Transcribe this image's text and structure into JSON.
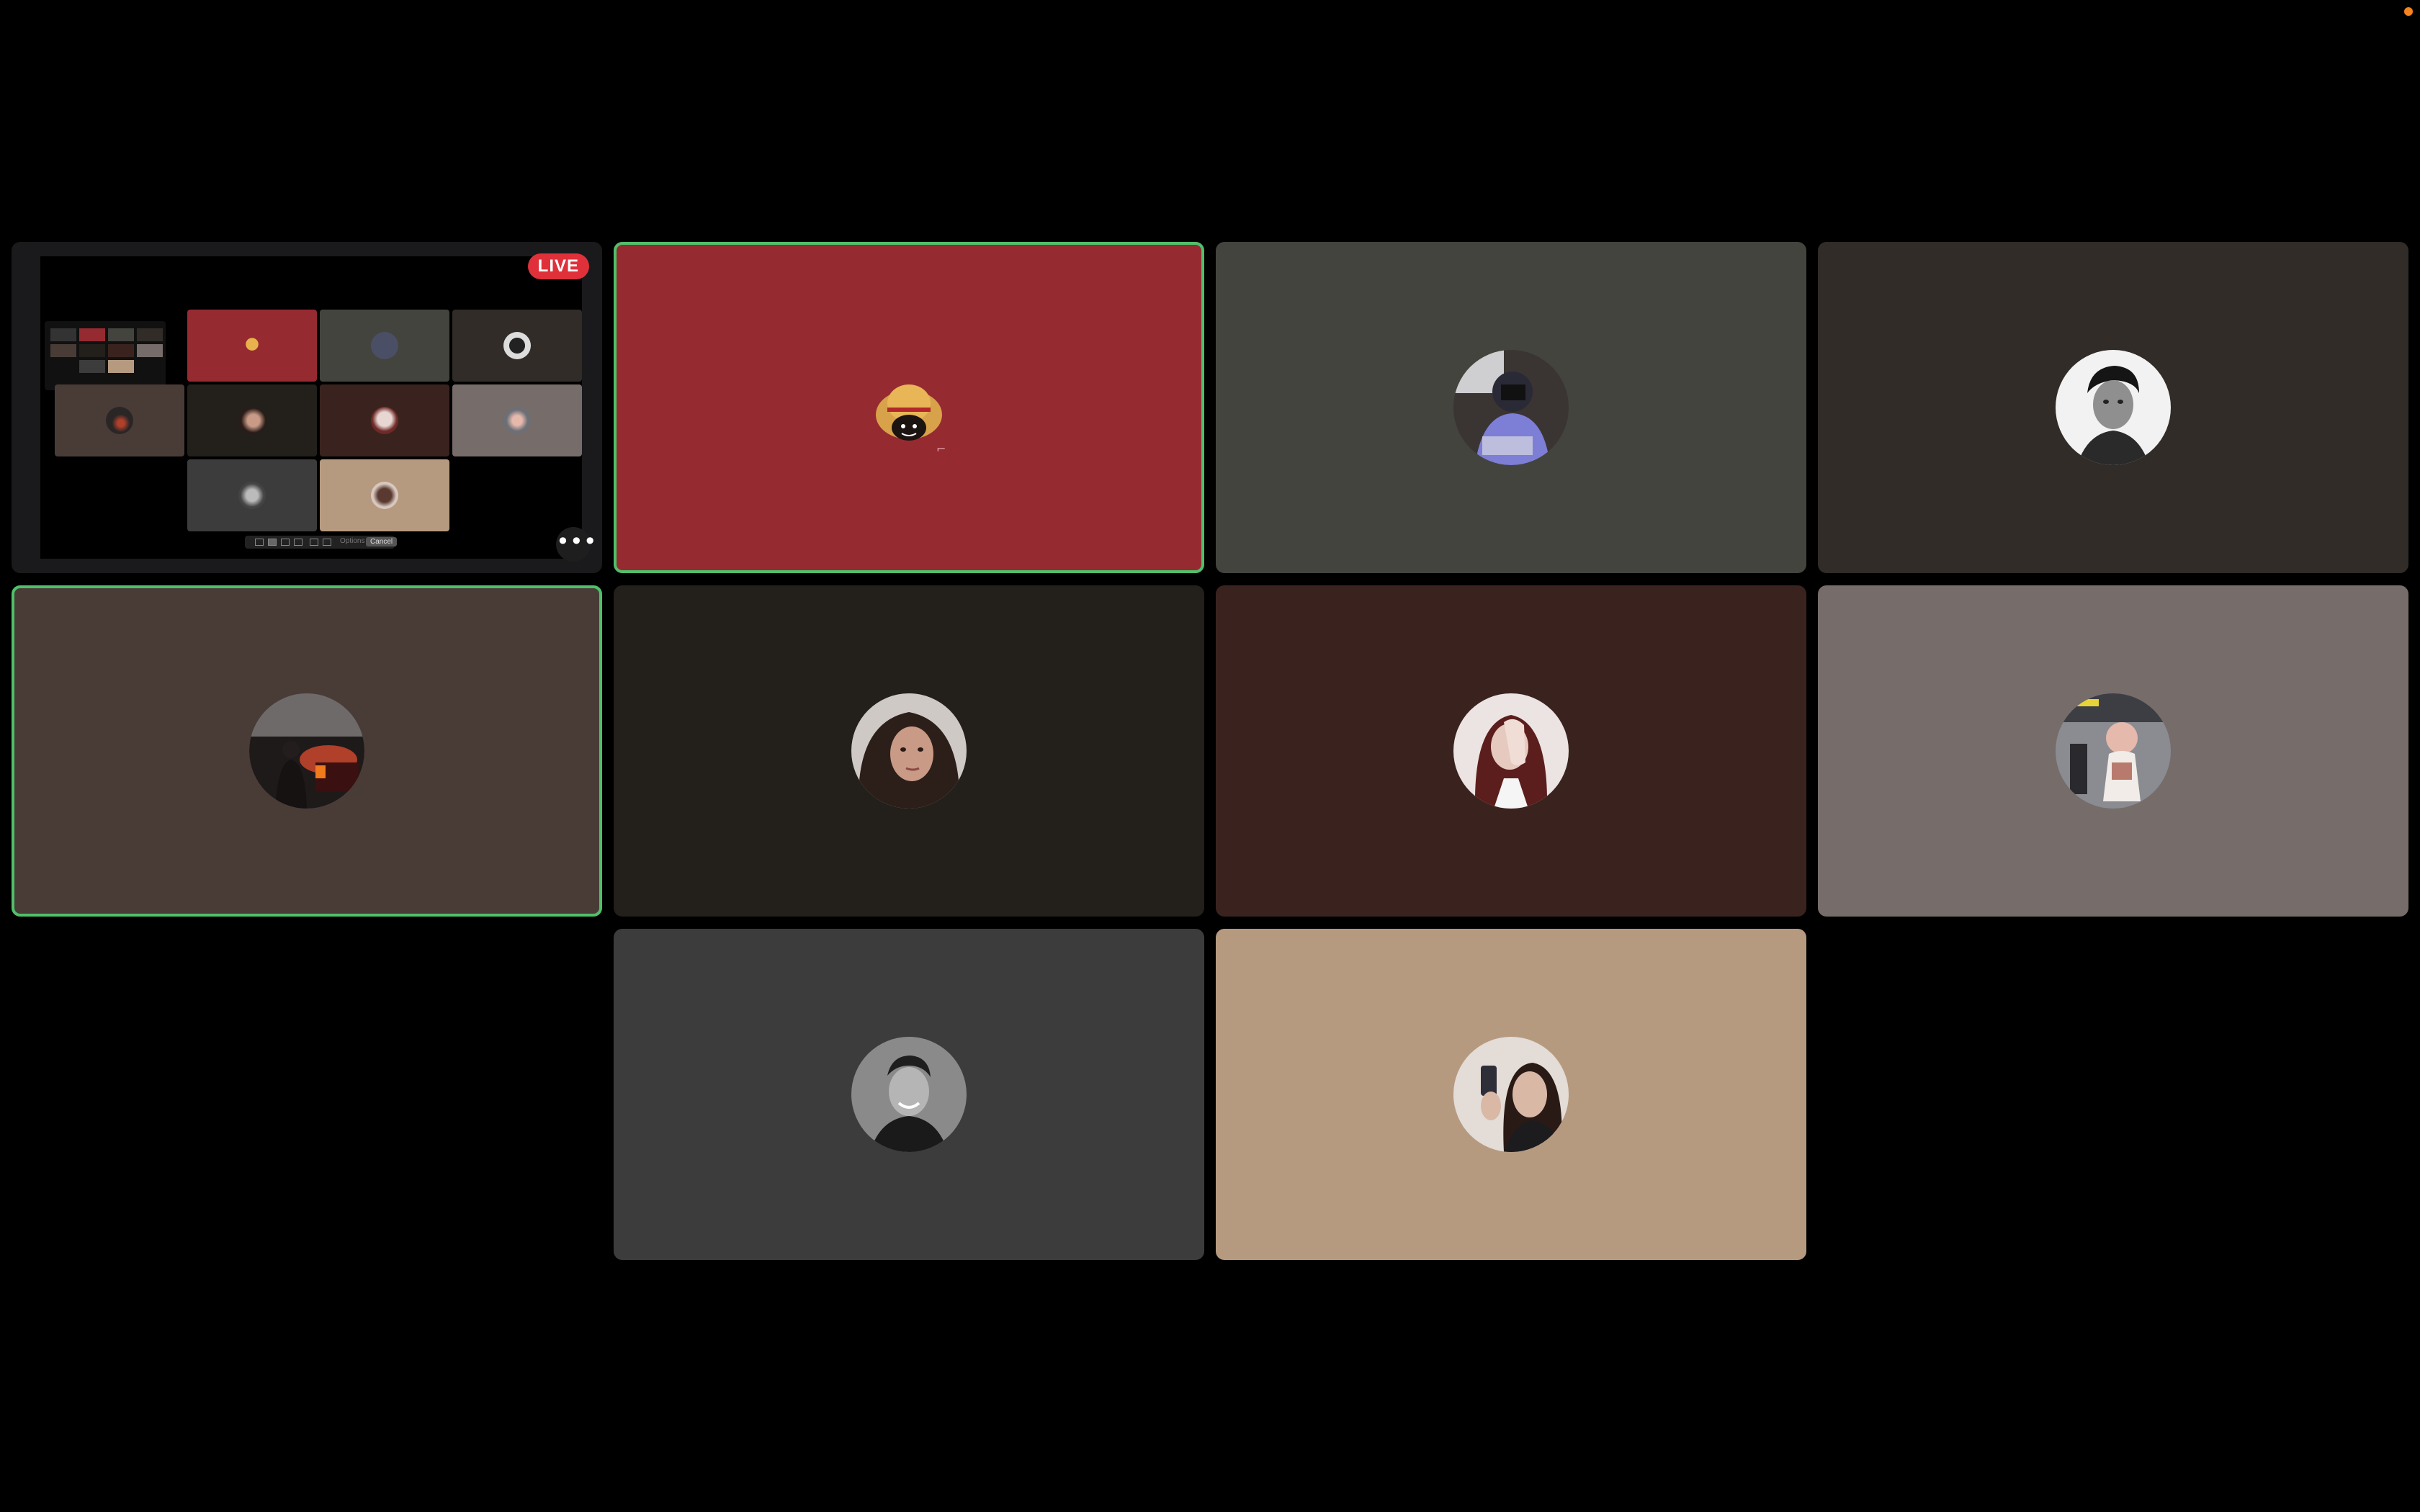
{
  "share_preview": {
    "live_label": "LIVE",
    "more_label": "•••",
    "toolbar_link": "Options",
    "toolbar_button": "Cancel"
  },
  "participants": [
    {
      "id": "p1",
      "bg": "#962a31",
      "active": true,
      "avatar": "straw-hat-cartoon-avatar"
    },
    {
      "id": "p2",
      "bg": "#43443e",
      "active": false,
      "avatar": "person-at-desk-avatar"
    },
    {
      "id": "p3",
      "bg": "#312c28",
      "active": false,
      "avatar": "black-white-portrait-avatar"
    },
    {
      "id": "p4",
      "bg": "#493c37",
      "active": true,
      "avatar": "night-street-avatar"
    },
    {
      "id": "p5",
      "bg": "#231f1b",
      "active": false,
      "avatar": "woman-portrait-avatar"
    },
    {
      "id": "p6",
      "bg": "#3a231e",
      "active": false,
      "avatar": "hand-over-face-avatar"
    },
    {
      "id": "p7",
      "bg": "#766c69",
      "active": false,
      "avatar": "airport-plush-avatar"
    },
    {
      "id": "p8",
      "bg": "#3c3c3c",
      "active": false,
      "avatar": "smiling-man-bw-avatar"
    },
    {
      "id": "p9",
      "bg": "#b69a80",
      "active": false,
      "avatar": "mirror-selfie-avatar"
    }
  ],
  "colors": {
    "background": "#000000",
    "active_border": "#4fc06a",
    "live_badge": "#e0313a",
    "status_dot": "#f5831f"
  }
}
